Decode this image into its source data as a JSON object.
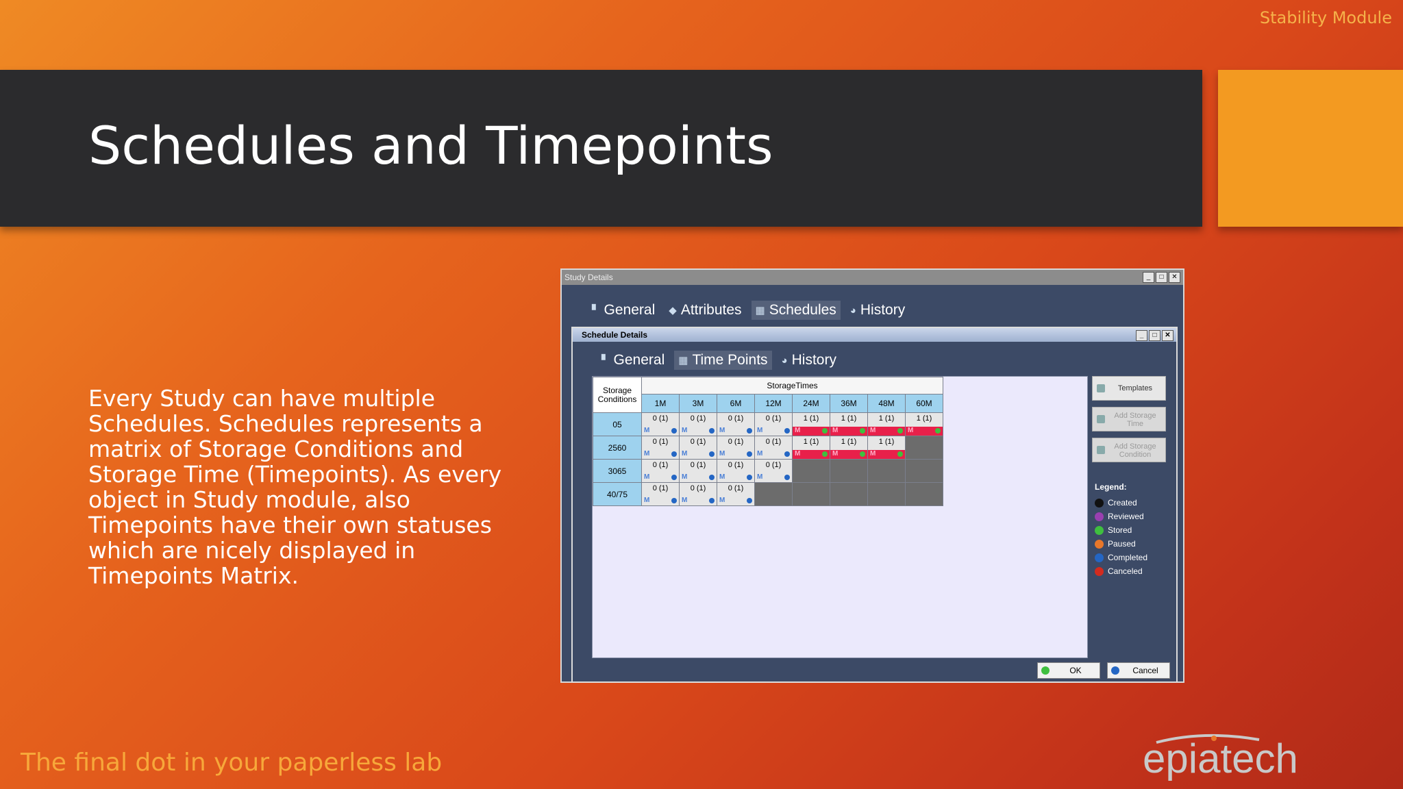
{
  "header": {
    "module": "Stability Module",
    "title": "Schedules and Timepoints"
  },
  "body": {
    "text": "Every Study can have multiple Schedules. Schedules represents a matrix of Storage Conditions and Storage Time (Timepoints). As every object in Study module, also Timepoints have their own statuses which are nicely displayed in Timepoints Matrix."
  },
  "footer": {
    "tagline": "The final dot in your paperless lab",
    "logo": "epiatech"
  },
  "study_window": {
    "title": "Study Details",
    "tabs": [
      "General",
      "Attributes",
      "Schedules",
      "History"
    ],
    "active_tab": "Schedules"
  },
  "schedule_window": {
    "title": "Schedule Details",
    "tabs": [
      "General",
      "Time Points",
      "History"
    ],
    "active_tab": "Time Points",
    "matrix": {
      "corner_label": "Storage Conditions",
      "group_label": "StorageTimes",
      "times": [
        "1M",
        "3M",
        "6M",
        "12M",
        "24M",
        "36M",
        "48M",
        "60M"
      ],
      "rows": [
        {
          "condition": "05",
          "cells": [
            "0 (1)",
            "0 (1)",
            "0 (1)",
            "0 (1)",
            "1 (1)",
            "1 (1)",
            "1 (1)",
            "1 (1)"
          ]
        },
        {
          "condition": "2560",
          "cells": [
            "0 (1)",
            "0 (1)",
            "0 (1)",
            "0 (1)",
            "1 (1)",
            "1 (1)",
            "1 (1)",
            ""
          ]
        },
        {
          "condition": "3065",
          "cells": [
            "0 (1)",
            "0 (1)",
            "0 (1)",
            "0 (1)",
            "",
            "",
            "",
            ""
          ]
        },
        {
          "condition": "40/75",
          "cells": [
            "0 (1)",
            "0 (1)",
            "0 (1)",
            "",
            "",
            "",
            "",
            ""
          ]
        }
      ],
      "cell_marker": "M"
    },
    "side": {
      "templates": "Templates",
      "add_time": "Add Storage Time",
      "add_condition": "Add Storage Condition"
    },
    "legend": {
      "title": "Legend:",
      "items": [
        {
          "label": "Created",
          "color": "#111111"
        },
        {
          "label": "Reviewed",
          "color": "#9a3fb0"
        },
        {
          "label": "Stored",
          "color": "#3fbf3f"
        },
        {
          "label": "Paused",
          "color": "#e8772a"
        },
        {
          "label": "Completed",
          "color": "#2466c4"
        },
        {
          "label": "Canceled",
          "color": "#d32b1e"
        }
      ]
    },
    "buttons": {
      "ok": "OK",
      "cancel": "Cancel"
    }
  },
  "window_controls": {
    "minimize": "_",
    "maximize": "□",
    "close": "✕"
  },
  "colors": {
    "accent": "#f39a21",
    "title_bg": "#2b2b2d",
    "tagline": "#f7a83a"
  }
}
